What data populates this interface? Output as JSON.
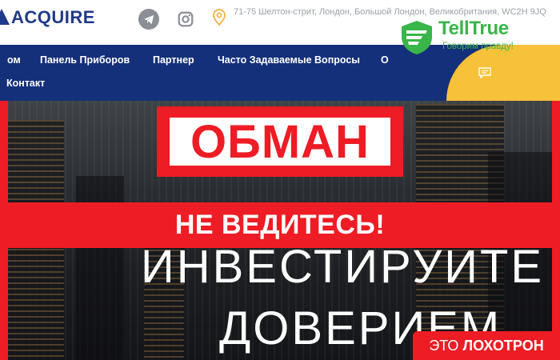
{
  "header": {
    "logo_text": "ACQUIRE",
    "address": "71-75 Шелтон-стрит, Лондон, Большой Лондон, Великобритания, WC2H 9JQ"
  },
  "nav": {
    "items": [
      "ом",
      "Панель Приборов",
      "Партнер",
      "Часто Задаваемые Вопросы",
      "О",
      "Контакт"
    ]
  },
  "badge": {
    "title": "TellTrue",
    "slogan": "Говорим правду!"
  },
  "overlay": {
    "scam_title": "ОБМАН",
    "warning": "НЕ ВЕДИТЕСЬ!",
    "tag_prefix": "ЭТО",
    "tag_strong": "ЛОХОТРОН"
  },
  "hero": {
    "line1": "ИНВЕСТИРУЙТЕ",
    "line2": "ДОВЕРИЕМ"
  },
  "colors": {
    "brand_navy": "#15307a",
    "alert_red": "#ee1c24",
    "badge_green": "#39b54a",
    "accent_yellow": "#f8c13a"
  }
}
